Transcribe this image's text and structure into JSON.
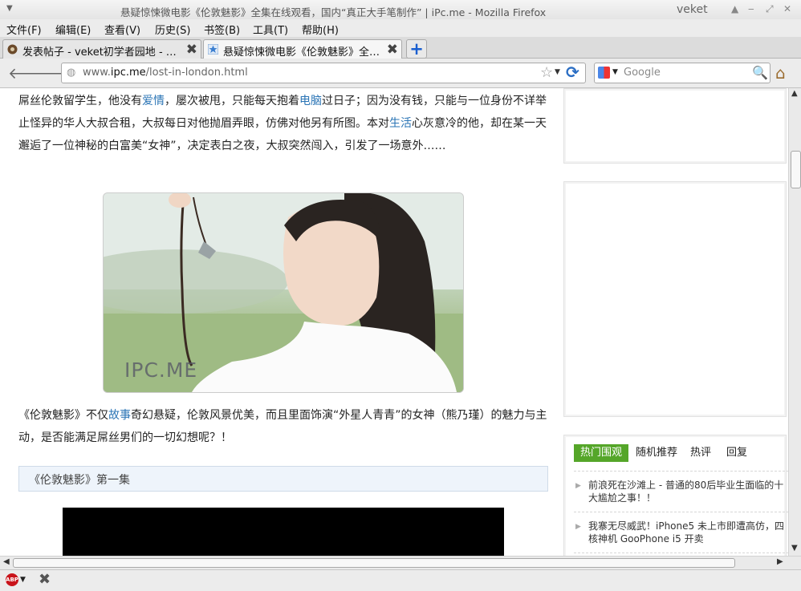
{
  "window": {
    "title": "悬疑惊悚微电影《伦敦魅影》全集在线观看，国内“真正大手笔制作” | iPc.me - Mozilla Firefox",
    "user": "veket",
    "controls": [
      "▲",
      "‒",
      "⤢",
      "✕"
    ]
  },
  "menu": [
    "文件(F)",
    "编辑(E)",
    "查看(V)",
    "历史(S)",
    "书签(B)",
    "工具(T)",
    "帮助(H)"
  ],
  "tabs": [
    {
      "label": "发表帖子 - veket初学者园地 - …",
      "active": false
    },
    {
      "label": "悬疑惊悚微电影《伦敦魅影》全…",
      "active": true
    }
  ],
  "nav": {
    "url_prefix": "www.",
    "url_host": "ipc.me",
    "url_path": "/lost-in-london.html",
    "search_placeholder": "Google"
  },
  "article": {
    "p1": [
      {
        "t": "屌丝伦敦留学生，他没有"
      },
      {
        "t": "爱情",
        "link": true
      },
      {
        "t": "，屡次被甩，只能每天抱着"
      },
      {
        "t": "电脑",
        "link": true
      },
      {
        "t": "过日子；因为没有钱，只能与一位身份不详举止怪异的华人大叔合租，大叔每日对他抛眉弄眼，仿佛对他另有所图。本对"
      },
      {
        "t": "生活",
        "link": true
      },
      {
        "t": "心灰意冷的他，却在某一天邂逅了一位神秘的白富美“女神”，决定表白之夜，大叔突然闯入，引发了一场意外……"
      }
    ],
    "image_watermark": "IPC.ME",
    "p2": [
      {
        "t": "《伦敦魅影》不仅"
      },
      {
        "t": "故事",
        "link": true
      },
      {
        "t": "奇幻悬疑，伦敦风景优美，而且里面饰演“外星人青青”的女神（熊乃瑾）的魅力与主动，是否能满足屌丝男们的一切幻想呢？！"
      }
    ],
    "section_title": "《伦敦魅影》第一集"
  },
  "sidebar": {
    "tabs": [
      "热门围观",
      "随机推荐",
      "热评",
      "回复"
    ],
    "items": [
      "前浪死在沙滩上 - 普通的80后毕业生面临的十大尴尬之事！！",
      "我寨无尽威武！iPhone5 未上市即遭高仿，四核神机 GooPhone i5 开卖"
    ]
  },
  "status": {
    "abp_label": "ABP"
  },
  "colors": {
    "link": "#2a74b5",
    "tab_active_green": "#55a629",
    "section_bg": "#eef4fb"
  }
}
